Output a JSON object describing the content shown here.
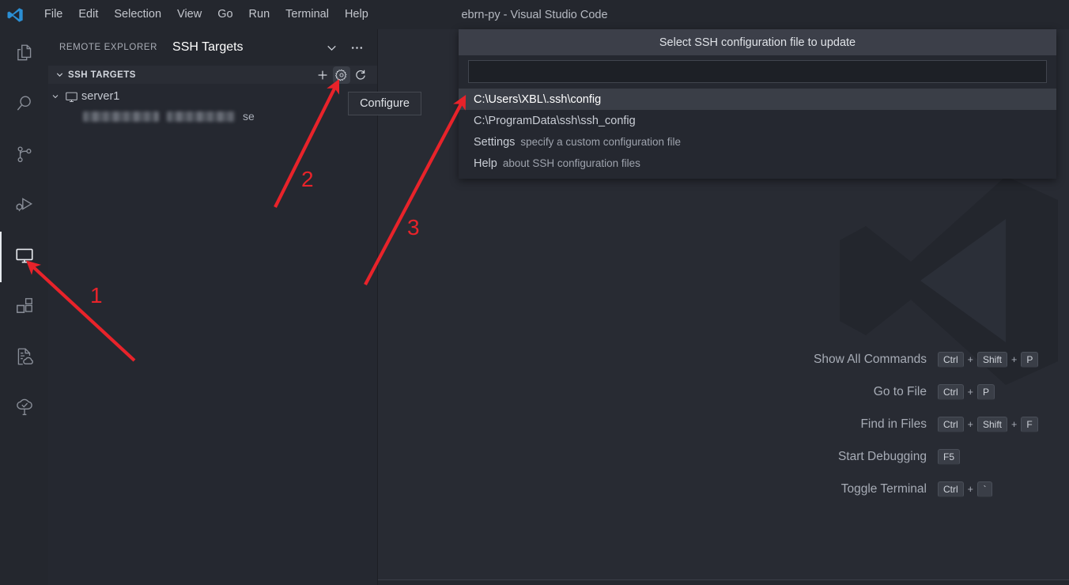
{
  "window": {
    "title": "ebrn-py - Visual Studio Code",
    "logo_icon": "vscode-logo-icon"
  },
  "menubar": {
    "items": [
      {
        "label": "File"
      },
      {
        "label": "Edit"
      },
      {
        "label": "Selection"
      },
      {
        "label": "View"
      },
      {
        "label": "Go"
      },
      {
        "label": "Run"
      },
      {
        "label": "Terminal"
      },
      {
        "label": "Help"
      }
    ]
  },
  "activitybar": {
    "items": [
      {
        "icon": "explorer-files-icon",
        "name": "explorer",
        "active": false
      },
      {
        "icon": "search-icon",
        "name": "search",
        "active": false
      },
      {
        "icon": "source-control-branch-icon",
        "name": "source-control",
        "active": false
      },
      {
        "icon": "run-and-debug-icon",
        "name": "run-and-debug",
        "active": false
      },
      {
        "icon": "remote-explorer-monitor-icon",
        "name": "remote-explorer",
        "active": true
      },
      {
        "icon": "extensions-blocks-icon",
        "name": "extensions",
        "active": false
      },
      {
        "icon": "file-cloud-icon",
        "name": "remote-file-sync",
        "active": false
      },
      {
        "icon": "tree-check-icon",
        "name": "project-tree",
        "active": false
      }
    ]
  },
  "sidebar": {
    "header": {
      "title": "REMOTE EXPLORER",
      "tab_label": "SSH Targets",
      "chevron_icon": "chevron-down-icon",
      "more_icon": "ellipsis-icon"
    },
    "section": {
      "title": "SSH TARGETS",
      "chevron_icon": "chevron-down-icon",
      "actions": [
        {
          "name": "add-new-ssh-host-button",
          "icon": "plus-icon"
        },
        {
          "name": "configure-button",
          "icon": "gear-icon",
          "highlighted": true
        },
        {
          "name": "refresh-button",
          "icon": "refresh-icon"
        }
      ]
    },
    "tree": {
      "items": [
        {
          "label": "server1",
          "icon": "monitor-icon",
          "chevron_icon": "chevron-down-icon",
          "expanded": true,
          "child": {
            "redacted": true,
            "visible_tail": "se"
          }
        }
      ]
    }
  },
  "tooltip": {
    "label": "Configure"
  },
  "quickpick": {
    "title": "Select SSH configuration file to update",
    "input_value": "",
    "input_placeholder": "",
    "items": [
      {
        "main": "C:\\Users\\XBL\\.ssh\\config",
        "desc": "",
        "selected": true
      },
      {
        "main": "C:\\ProgramData\\ssh\\ssh_config",
        "desc": "",
        "selected": false
      },
      {
        "main": "Settings",
        "desc": "specify a custom configuration file",
        "selected": false
      },
      {
        "main": "Help",
        "desc": "about SSH configuration files",
        "selected": false
      }
    ]
  },
  "editor": {
    "watermark_icon": "vscode-logo-watermark",
    "shortcuts": [
      {
        "label": "Show All Commands",
        "keys": [
          "Ctrl",
          "+",
          "Shift",
          "+",
          "P"
        ]
      },
      {
        "label": "Go to File",
        "keys": [
          "Ctrl",
          "+",
          "P"
        ]
      },
      {
        "label": "Find in Files",
        "keys": [
          "Ctrl",
          "+",
          "Shift",
          "+",
          "F"
        ]
      },
      {
        "label": "Start Debugging",
        "keys": [
          "F5"
        ]
      },
      {
        "label": "Toggle Terminal",
        "keys": [
          "Ctrl",
          "+",
          "`"
        ]
      }
    ]
  },
  "annotations": {
    "color": "#e8232a",
    "markers": [
      {
        "number": "1",
        "points_to": "remote-explorer-activity-icon"
      },
      {
        "number": "2",
        "points_to": "configure-gear-button"
      },
      {
        "number": "3",
        "points_to": "quickpick-first-item"
      }
    ]
  }
}
